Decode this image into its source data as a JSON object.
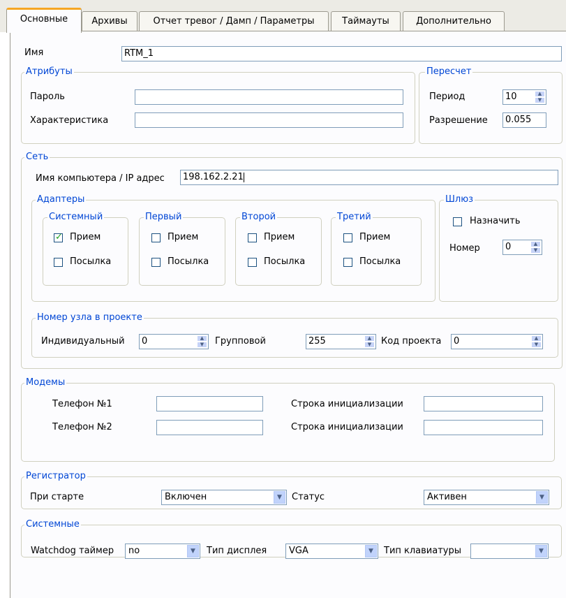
{
  "tabs": [
    "Основные",
    "Архивы",
    "Отчет тревог / Дамп / Параметры",
    "Таймауты",
    "Дополнительно"
  ],
  "name": {
    "label": "Имя",
    "value": "RTM_1"
  },
  "attributes": {
    "title": "Атрибуты",
    "password_label": "Пароль",
    "password_value": "",
    "characteristic_label": "Характеристика",
    "characteristic_value": ""
  },
  "recalc": {
    "title": "Пересчет",
    "period_label": "Период",
    "period_value": "10",
    "resolution_label": "Разрешение",
    "resolution_value": "0.055"
  },
  "network": {
    "title": "Сеть",
    "host_label": "Имя компьютера / IP адрес",
    "host_value": "198.162.2.21",
    "adapters": {
      "title": "Адаптеры",
      "receive_label": "Прием",
      "send_label": "Посылка",
      "groups": [
        {
          "title": "Системный",
          "receive": true,
          "send": false
        },
        {
          "title": "Первый",
          "receive": false,
          "send": false
        },
        {
          "title": "Второй",
          "receive": false,
          "send": false
        },
        {
          "title": "Третий",
          "receive": false,
          "send": false
        }
      ]
    },
    "gateway": {
      "title": "Шлюз",
      "assign_label": "Назначить",
      "assign": false,
      "number_label": "Номер",
      "number_value": "0"
    },
    "node": {
      "title": "Номер узла в проекте",
      "individual_label": "Индивидуальный",
      "individual_value": "0",
      "group_label": "Групповой",
      "group_value": "255",
      "project_label": "Код проекта",
      "project_value": "0"
    }
  },
  "modems": {
    "title": "Модемы",
    "phone1_label": "Телефон №1",
    "phone1_value": "",
    "phone2_label": "Телефон №2",
    "phone2_value": "",
    "init1_label": "Строка инициализации",
    "init1_value": "",
    "init2_label": "Строка инициализации",
    "init2_value": ""
  },
  "recorder": {
    "title": "Регистратор",
    "startup_label": "При старте",
    "startup_value": "Включен",
    "status_label": "Статус",
    "status_value": "Активен"
  },
  "system": {
    "title": "Системные",
    "watchdog_label": "Watchdog таймер",
    "watchdog_value": "no",
    "display_label": "Тип дисплея",
    "display_value": "VGA",
    "keyboard_label": "Тип клавиатуры",
    "keyboard_value": ""
  },
  "colors": {
    "accent": "#f6a623",
    "group_title": "#0046d5",
    "border": "#7f9db9"
  }
}
